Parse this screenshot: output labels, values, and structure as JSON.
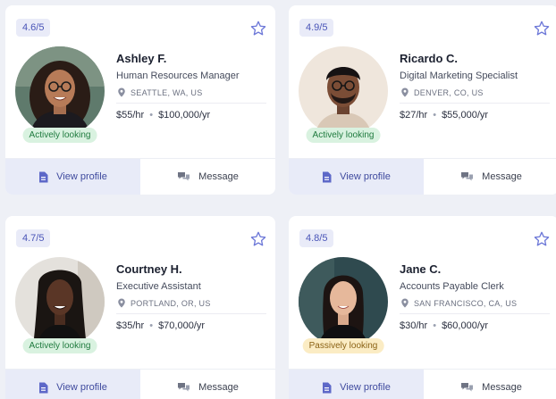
{
  "candidates": [
    {
      "rating": "4.6/5",
      "name": "Ashley F.",
      "title": "Human Resources Manager",
      "location": "SEATTLE, WA, US",
      "rate": "$55/hr",
      "salary": "$100,000/yr",
      "status": "Actively looking",
      "status_kind": "active",
      "view_label": "View profile",
      "message_label": "Message"
    },
    {
      "rating": "4.9/5",
      "name": "Ricardo C.",
      "title": "Digital Marketing Specialist",
      "location": "DENVER, CO, US",
      "rate": "$27/hr",
      "salary": "$55,000/yr",
      "status": "Actively looking",
      "status_kind": "active",
      "view_label": "View profile",
      "message_label": "Message"
    },
    {
      "rating": "4.7/5",
      "name": "Courtney H.",
      "title": "Executive Assistant",
      "location": "PORTLAND, OR, US",
      "rate": "$35/hr",
      "salary": "$70,000/yr",
      "status": "Actively looking",
      "status_kind": "active",
      "view_label": "View profile",
      "message_label": "Message"
    },
    {
      "rating": "4.8/5",
      "name": "Jane C.",
      "title": "Accounts Payable Clerk",
      "location": "SAN FRANCISCO, CA, US",
      "rate": "$30/hr",
      "salary": "$60,000/yr",
      "status": "Passively looking",
      "status_kind": "passive",
      "view_label": "View profile",
      "message_label": "Message"
    }
  ],
  "pay_separator": "•",
  "colors": {
    "accent": "#4a55b8",
    "active_badge": "#d9f2e0",
    "passive_badge": "#fbecc4",
    "view_button_bg": "#e8ebf8"
  },
  "icons": {
    "favorite": "star-icon",
    "location": "location-pin-icon",
    "view": "document-icon",
    "message": "chat-bubbles-icon"
  }
}
